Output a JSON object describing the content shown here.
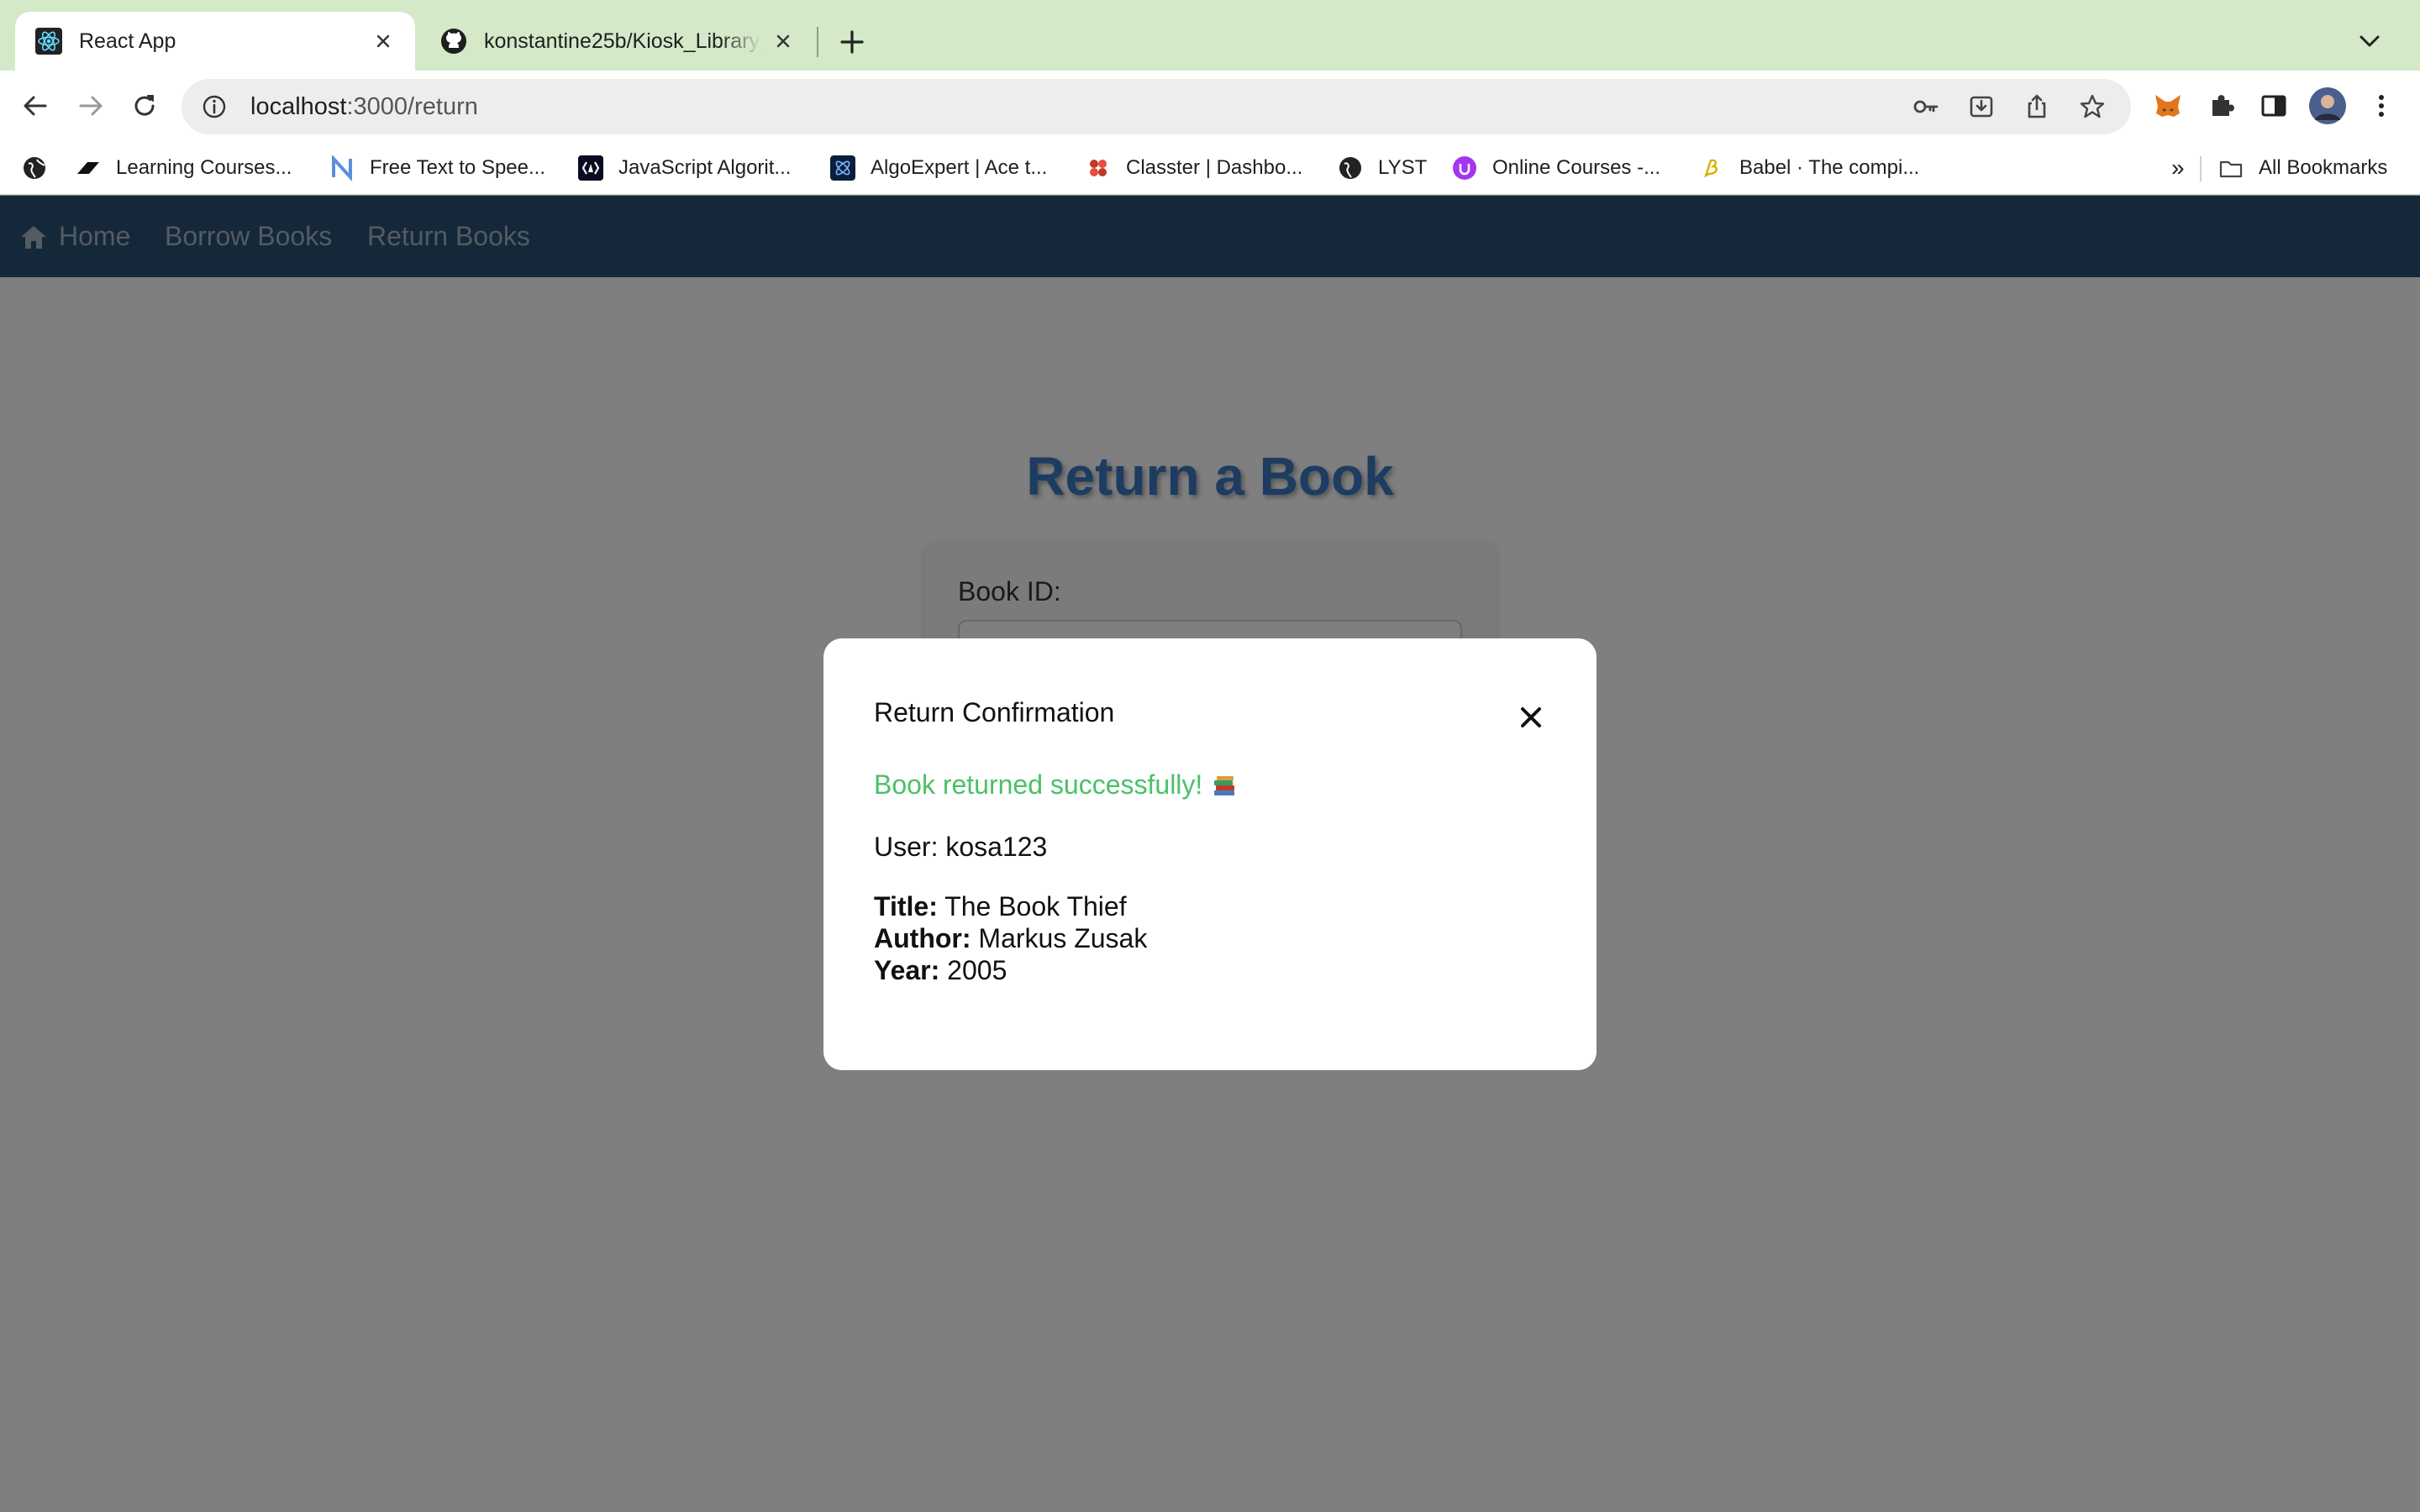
{
  "browser": {
    "tabs": [
      {
        "title": "React App",
        "active": true,
        "icon": "react-icon"
      },
      {
        "title": "konstantine25b/Kiosk_Library_System",
        "active": false,
        "icon": "github-icon"
      }
    ],
    "url": {
      "host": "localhost",
      "path": ":3000/return"
    },
    "bookmarks": [
      {
        "label": "Learning Courses...",
        "icon": "blackboard-icon"
      },
      {
        "label": "Free Text to Spee...",
        "icon": "naturalreader-icon"
      },
      {
        "label": "JavaScript Algorit...",
        "icon": "freecodecamp-icon"
      },
      {
        "label": "AlgoExpert | Ace t...",
        "icon": "algoexpert-icon"
      },
      {
        "label": "Classter | Dashbo...",
        "icon": "classter-icon"
      },
      {
        "label": "LYST",
        "icon": "globe-icon"
      },
      {
        "label": "Online Courses -...",
        "icon": "udemy-icon"
      },
      {
        "label": "Babel · The compi...",
        "icon": "babel-icon"
      }
    ],
    "overflow_label": "»",
    "all_bookmarks": "All Bookmarks"
  },
  "nav": {
    "home": "Home",
    "borrow": "Borrow Books",
    "return": "Return Books"
  },
  "page": {
    "title": "Return a Book",
    "book_id_label": "Book ID:"
  },
  "modal": {
    "title": "Return Confirmation",
    "success": "Book returned successfully!",
    "user": "User: kosa123",
    "title_label": "Title:",
    "title_value": "The Book Thief",
    "author_label": "Author:",
    "author_value": "Markus Zusak",
    "year_label": "Year:",
    "year_value": "2005"
  },
  "colors": {
    "tabstrip": "#d3e9c8",
    "appbar": "#2b5072",
    "page_title": "#3a78c2",
    "success": "#4bc069"
  }
}
